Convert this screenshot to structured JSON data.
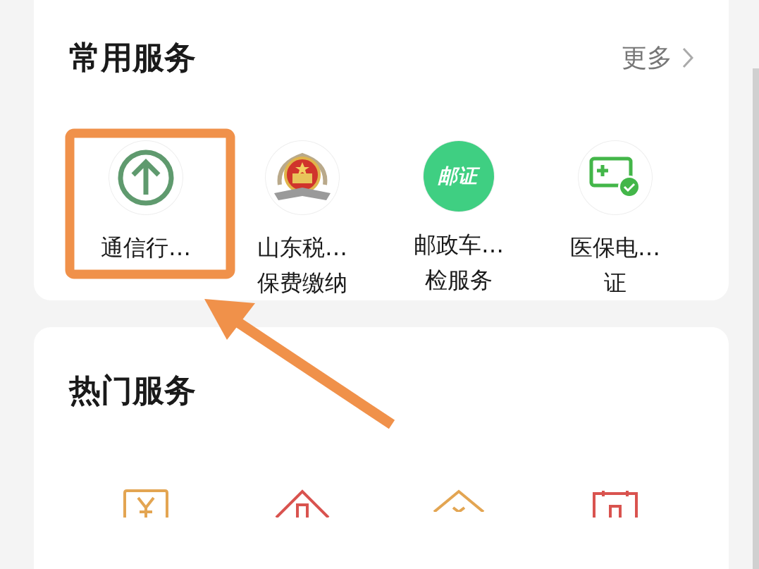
{
  "common_services": {
    "title": "常用服务",
    "more": "更多",
    "items": [
      {
        "kind": "arrow",
        "lines": [
          "通信行…"
        ]
      },
      {
        "kind": "emblem",
        "lines": [
          "山东税…",
          "保费缴纳"
        ]
      },
      {
        "kind": "logo",
        "logo_text": "邮证",
        "lines": [
          "邮政车…",
          "检服务"
        ]
      },
      {
        "kind": "card",
        "lines": [
          "医保电…",
          "证"
        ]
      }
    ]
  },
  "hot_services": {
    "title": "热门服务",
    "items": [
      {
        "kind": "yuan-box"
      },
      {
        "kind": "house-cross"
      },
      {
        "kind": "house-yuan"
      },
      {
        "kind": "calendar-cross"
      }
    ]
  },
  "annotations": {
    "highlight_frame": true,
    "pointer_arrow": true
  }
}
